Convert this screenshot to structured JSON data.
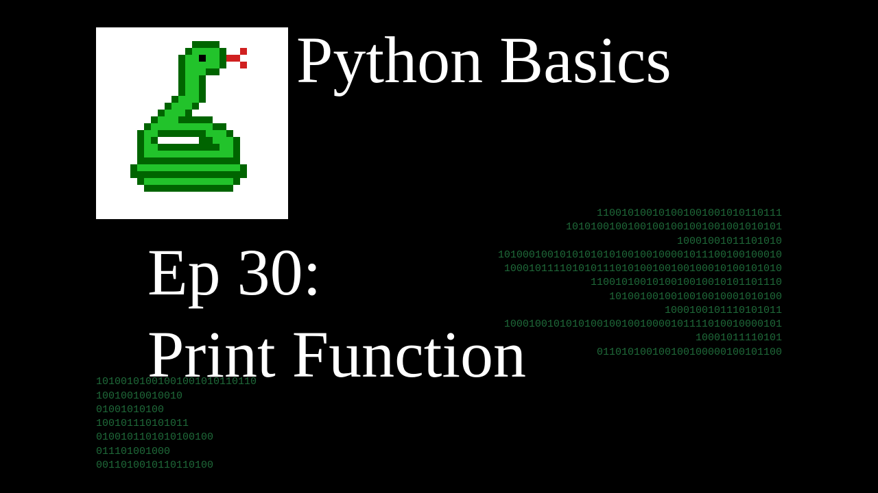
{
  "title": "Python Basics",
  "episode": "Ep 30:",
  "subtitle": "Print Function",
  "binary_right": "110010100101001001001010110111\n10101001001001001001001001001010101\n10001001011101010\n1010001001010101010100100100001011100100100010\n100010111101010111010100100100100010100101010\n1100101001010010010010101101110\n1010010010010010010001010100\n1000100101110101011\n100010010101010010010010000101111010010000101\n10001011110101\n011010100100100100000100101100\n",
  "binary_left": "10100101001001001010110110\n10010010010010\n01001010100\n100101110101011\n0100101101010100100\n011101001000\n0011010010110110100"
}
